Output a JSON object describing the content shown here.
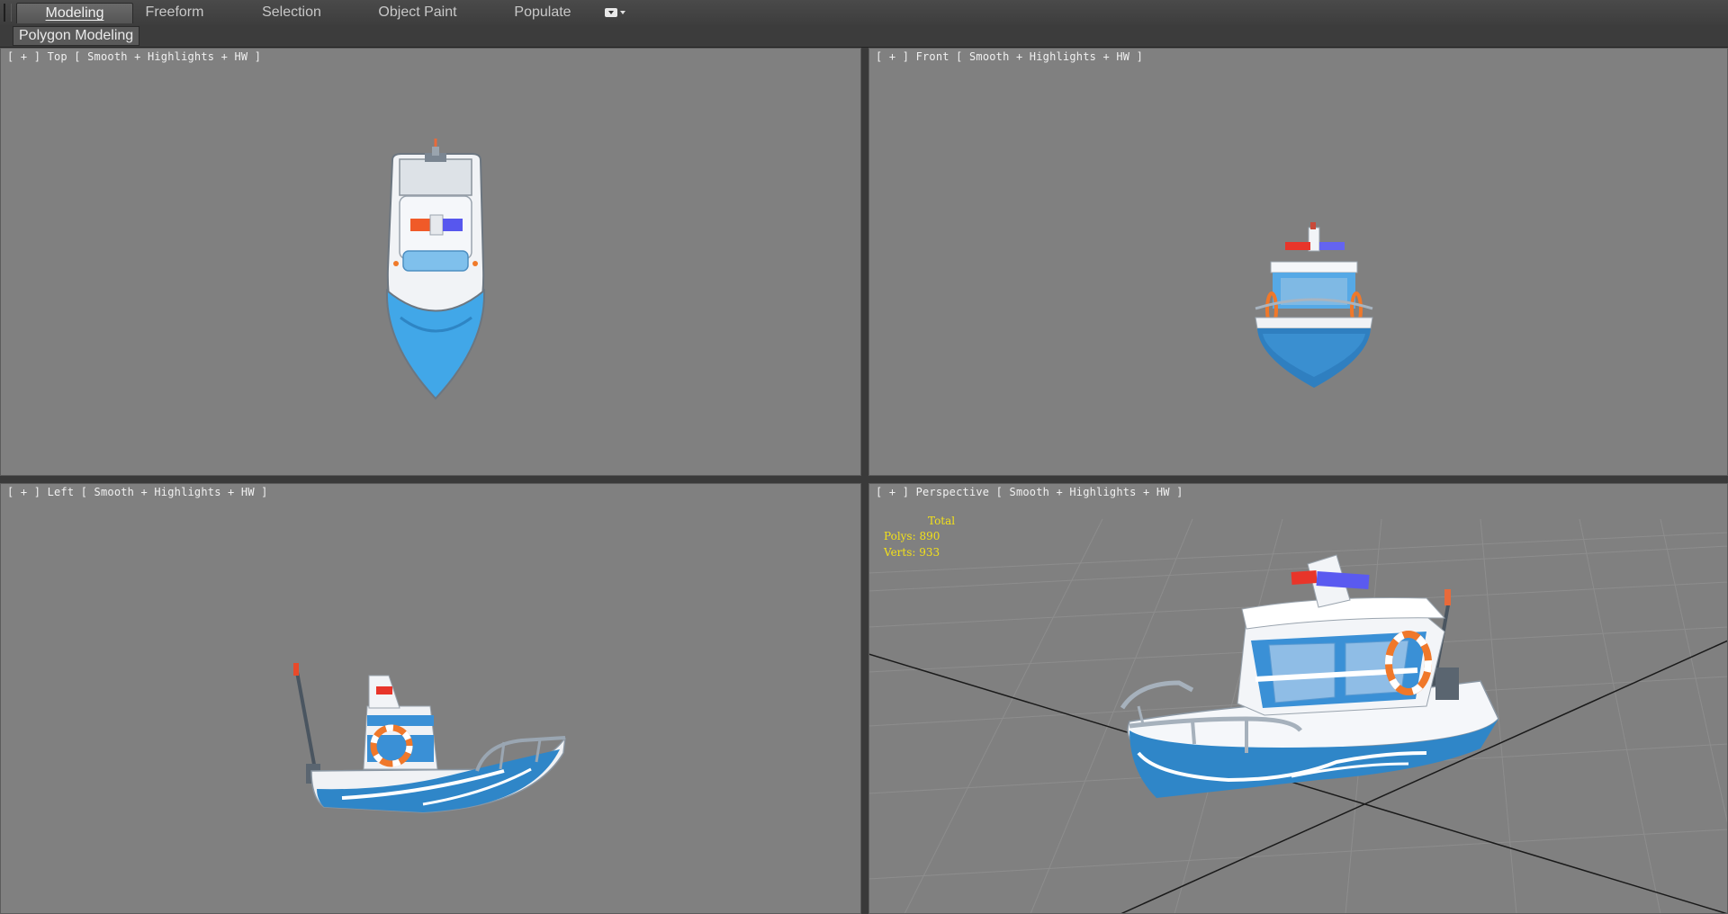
{
  "ribbon": {
    "tabs": [
      {
        "label": "Modeling",
        "active": true
      },
      {
        "label": "Freeform",
        "active": false
      },
      {
        "label": "Selection",
        "active": false
      },
      {
        "label": "Object Paint",
        "active": false
      },
      {
        "label": "Populate",
        "active": false
      }
    ],
    "panel_label": "Polygon Modeling"
  },
  "viewports": {
    "top": {
      "plus": "[ + ]",
      "name": "Top",
      "shading": "[ Smooth + Highlights + HW ]"
    },
    "front": {
      "plus": "[ + ]",
      "name": "Front",
      "shading": "[ Smooth + Highlights + HW ]"
    },
    "left": {
      "plus": "[ + ]",
      "name": "Left",
      "shading": "[ Smooth + Highlights + HW ]"
    },
    "perspective": {
      "plus": "[ + ]",
      "name": "Perspective",
      "shading": "[ Smooth + Highlights + HW ]"
    }
  },
  "stats": {
    "header": "Total",
    "polys": "Polys: 890",
    "verts": "Verts: 933"
  },
  "colors": {
    "viewport_bg": "#808080",
    "stats_text": "#f2e01a",
    "boat_blue": "#2f86c8",
    "boat_white": "#f0f2f5",
    "light_red": "#e8421a",
    "light_blue": "#5a5af0"
  }
}
